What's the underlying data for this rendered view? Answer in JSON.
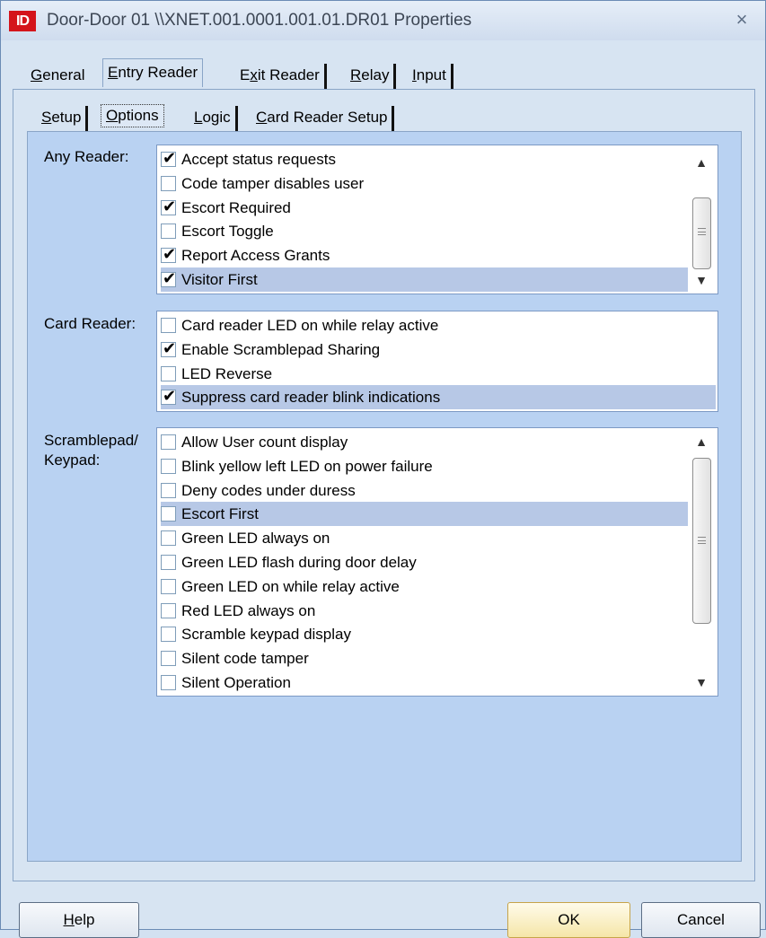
{
  "window": {
    "title": "Door-Door 01 \\\\XNET.001.0001.001.01.DR01 Properties",
    "app_icon_text": "ID",
    "close_glyph": "×"
  },
  "main_tabs": [
    {
      "pre": "",
      "u": "G",
      "post": "eneral"
    },
    {
      "pre": "",
      "u": "E",
      "post": "ntry Reader"
    },
    {
      "pre": "E",
      "u": "x",
      "post": "it Reader"
    },
    {
      "pre": "",
      "u": "R",
      "post": "elay"
    },
    {
      "pre": "",
      "u": "I",
      "post": "nput"
    }
  ],
  "sub_tabs": [
    {
      "pre": "",
      "u": "S",
      "post": "etup"
    },
    {
      "pre": "",
      "u": "O",
      "post": "ptions"
    },
    {
      "pre": "",
      "u": "L",
      "post": "ogic"
    },
    {
      "pre": "",
      "u": "C",
      "post": "ard Reader Setup"
    }
  ],
  "groups": {
    "any_reader": {
      "label": "Any Reader:",
      "items": [
        {
          "label": "Accept status requests",
          "checked": true
        },
        {
          "label": "Code tamper disables user",
          "checked": false
        },
        {
          "label": "Escort Required",
          "checked": true
        },
        {
          "label": "Escort Toggle",
          "checked": false
        },
        {
          "label": "Report Access Grants",
          "checked": true
        },
        {
          "label": "Visitor First",
          "checked": true,
          "selected": true
        }
      ]
    },
    "card_reader": {
      "label": "Card Reader:",
      "items": [
        {
          "label": "Card reader LED on while relay active",
          "checked": false
        },
        {
          "label": "Enable Scramblepad Sharing",
          "checked": true
        },
        {
          "label": "LED Reverse",
          "checked": false
        },
        {
          "label": "Suppress card reader blink indications",
          "checked": true,
          "selected": true
        }
      ]
    },
    "scramblepad": {
      "label_line1": "Scramblepad/",
      "label_line2": "Keypad:",
      "items": [
        {
          "label": "Allow User count display",
          "checked": false
        },
        {
          "label": "Blink yellow left LED on power failure",
          "checked": false
        },
        {
          "label": "Deny codes under duress",
          "checked": false
        },
        {
          "label": "Escort First",
          "checked": false,
          "selected": true
        },
        {
          "label": "Green LED always on",
          "checked": false
        },
        {
          "label": "Green LED flash during door delay",
          "checked": false
        },
        {
          "label": "Green LED on while relay active",
          "checked": false
        },
        {
          "label": "Red LED always on",
          "checked": false
        },
        {
          "label": "Scramble keypad display",
          "checked": false
        },
        {
          "label": "Silent code tamper",
          "checked": false
        },
        {
          "label": "Silent Operation",
          "checked": false
        }
      ]
    }
  },
  "buttons": {
    "help_u": "H",
    "help_rest": "elp",
    "ok": "OK",
    "cancel": "Cancel"
  },
  "glyphs": {
    "check": "✔",
    "scroll_up": "▲",
    "scroll_down": "▼"
  }
}
